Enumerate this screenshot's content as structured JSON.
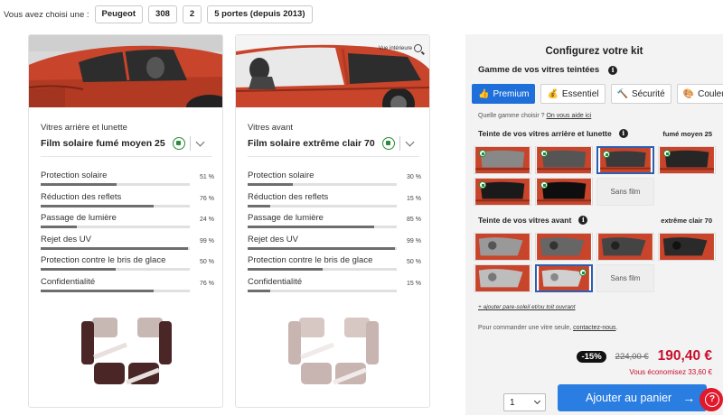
{
  "vehicle": {
    "label": "Vous avez choisi une :",
    "brand": "Peugeot",
    "model": "308",
    "generation": "2",
    "body": "5 portes (depuis 2013)"
  },
  "rear_card": {
    "section_label": "Vitres arrière et lunette",
    "film_name": "Film solaire fumé moyen 25",
    "metrics": [
      {
        "label": "Protection solaire",
        "value": "51 %",
        "percent": 51
      },
      {
        "label": "Réduction des reflets",
        "value": "76 %",
        "percent": 76
      },
      {
        "label": "Passage de lumière",
        "value": "24 %",
        "percent": 24
      },
      {
        "label": "Rejet des UV",
        "value": "99 %",
        "percent": 99
      },
      {
        "label": "Protection contre le bris de glace",
        "value": "50 %",
        "percent": 50
      },
      {
        "label": "Confidentialité",
        "value": "76 %",
        "percent": 76
      }
    ]
  },
  "front_card": {
    "view_interior": "Vue intérieure",
    "section_label": "Vitres avant",
    "film_name": "Film solaire extrême clair 70",
    "metrics": [
      {
        "label": "Protection solaire",
        "value": "30 %",
        "percent": 30
      },
      {
        "label": "Réduction des reflets",
        "value": "15 %",
        "percent": 15
      },
      {
        "label": "Passage de lumière",
        "value": "85 %",
        "percent": 85
      },
      {
        "label": "Rejet des UV",
        "value": "99 %",
        "percent": 99
      },
      {
        "label": "Protection contre le bris de glace",
        "value": "50 %",
        "percent": 50
      },
      {
        "label": "Confidentialité",
        "value": "15 %",
        "percent": 15
      }
    ]
  },
  "config": {
    "title": "Configurez votre kit",
    "gamme_label": "Gamme de vos vitres teintées",
    "info_glyph": "i",
    "tabs": [
      {
        "label": "Premium",
        "icon": "thumb-up-icon",
        "glyph": "👍",
        "active": true
      },
      {
        "label": "Essentiel",
        "icon": "money-bag-icon",
        "glyph": "💰",
        "active": false
      },
      {
        "label": "Sécurité",
        "icon": "hammer-icon",
        "glyph": "🔨",
        "active": false
      },
      {
        "label": "Couleur",
        "icon": "palette-icon",
        "glyph": "🎨",
        "active": false
      }
    ],
    "help_question": "Quelle gamme choisir ?",
    "help_link": "On vous aide ici",
    "rear_section": {
      "title": "Teinte de vos vitres arrière et lunette",
      "selected_value": "fumé moyen 25",
      "sans_film": "Sans film"
    },
    "front_section": {
      "title": "Teinte de vos vitres avant",
      "selected_value": "extrême clair 70",
      "sans_film": "Sans film"
    },
    "sunshade_link": "+ ajouter pare-soleil et/ou toit ouvrant",
    "order_note": "Pour commander une vitre seule,",
    "order_link": "contactez-nous",
    "order_end": ".",
    "discount": "-15%",
    "old_price": "224,00 €",
    "new_price": "190,40 €",
    "saving": "Vous économisez 33,60 €",
    "quantity": "1",
    "cart_button": "Ajouter au panier",
    "cart_arrow": "→",
    "help_glyph": "?"
  },
  "colors": {
    "accent": "#2a7de1",
    "price": "#c8102e",
    "car_body": "#c8442a"
  }
}
